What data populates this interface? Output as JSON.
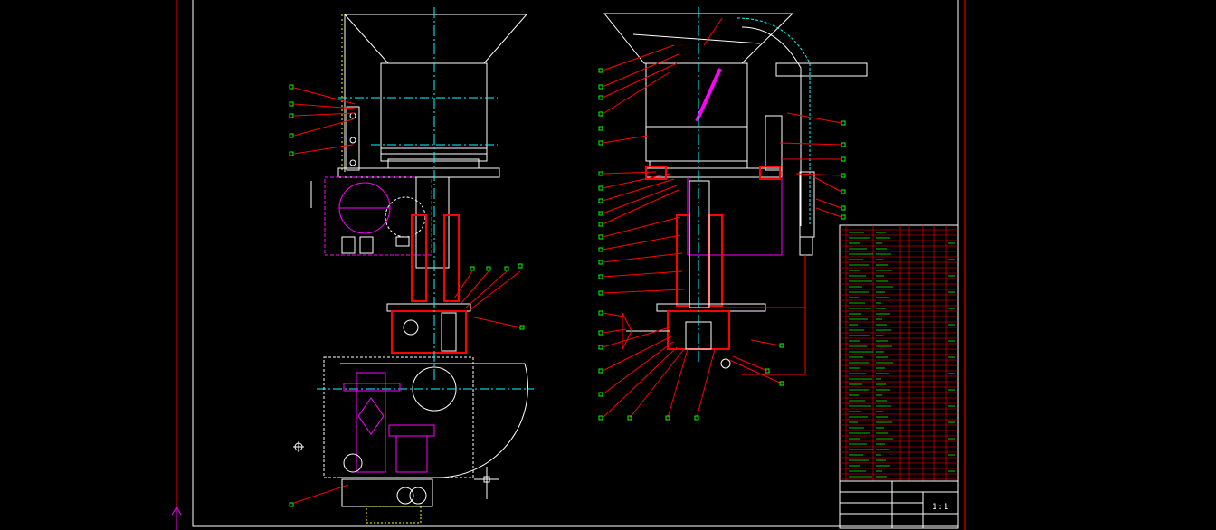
{
  "colors": {
    "background": "#000000",
    "frame": "#ff0000",
    "outline": "#ffffff",
    "centerline": "#00ffff",
    "section": "#ff0000",
    "motor": "#ff00ff",
    "callout_box": "#00ff00",
    "highlight": "#ffff00"
  },
  "title_block": {
    "drawing_number": "1:1"
  },
  "icons": {
    "ucs": "ucs-axis-icon",
    "crosshair": "crosshair-cursor-icon",
    "center_mark": "center-mark-icon"
  }
}
